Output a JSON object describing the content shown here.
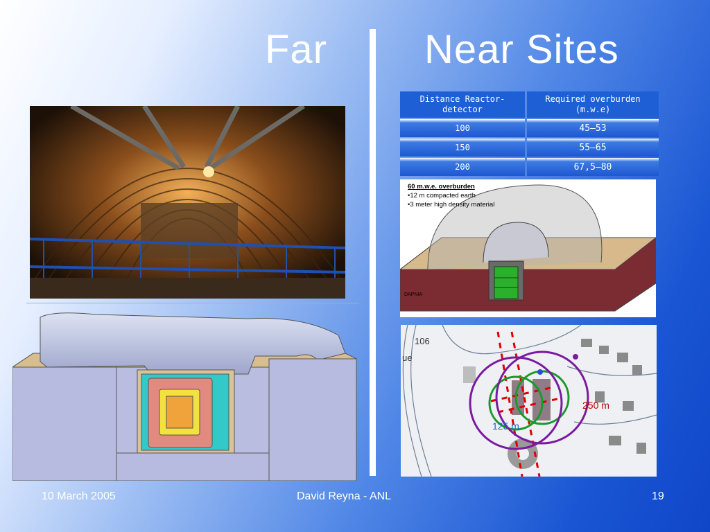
{
  "title": {
    "far": "Far",
    "near": "Near Sites"
  },
  "table": {
    "headers": [
      "Distance Reactor-detector",
      "Required overburden (m.w.e)"
    ],
    "rows": [
      [
        "100",
        "45–53"
      ],
      [
        "150",
        "55–65"
      ],
      [
        "200",
        "67,5–80"
      ]
    ]
  },
  "overburden_panel": {
    "heading": "60 m.w.e. overburden",
    "bullets": [
      "12 m compacted earth",
      "3 meter high density material"
    ],
    "logo": "DAPNIA"
  },
  "map": {
    "labels": [
      "250 m",
      "125 m",
      "106",
      "ue"
    ]
  },
  "footer": {
    "date": "10 March 2005",
    "author": "David Reyna - ANL",
    "page": "19"
  },
  "colors": {
    "accent": "#1f5fd6",
    "title": "#ffffff",
    "circle_purple": "#7a1aa0",
    "circle_green": "#1a9a2a",
    "marker_red": "#e00000"
  }
}
